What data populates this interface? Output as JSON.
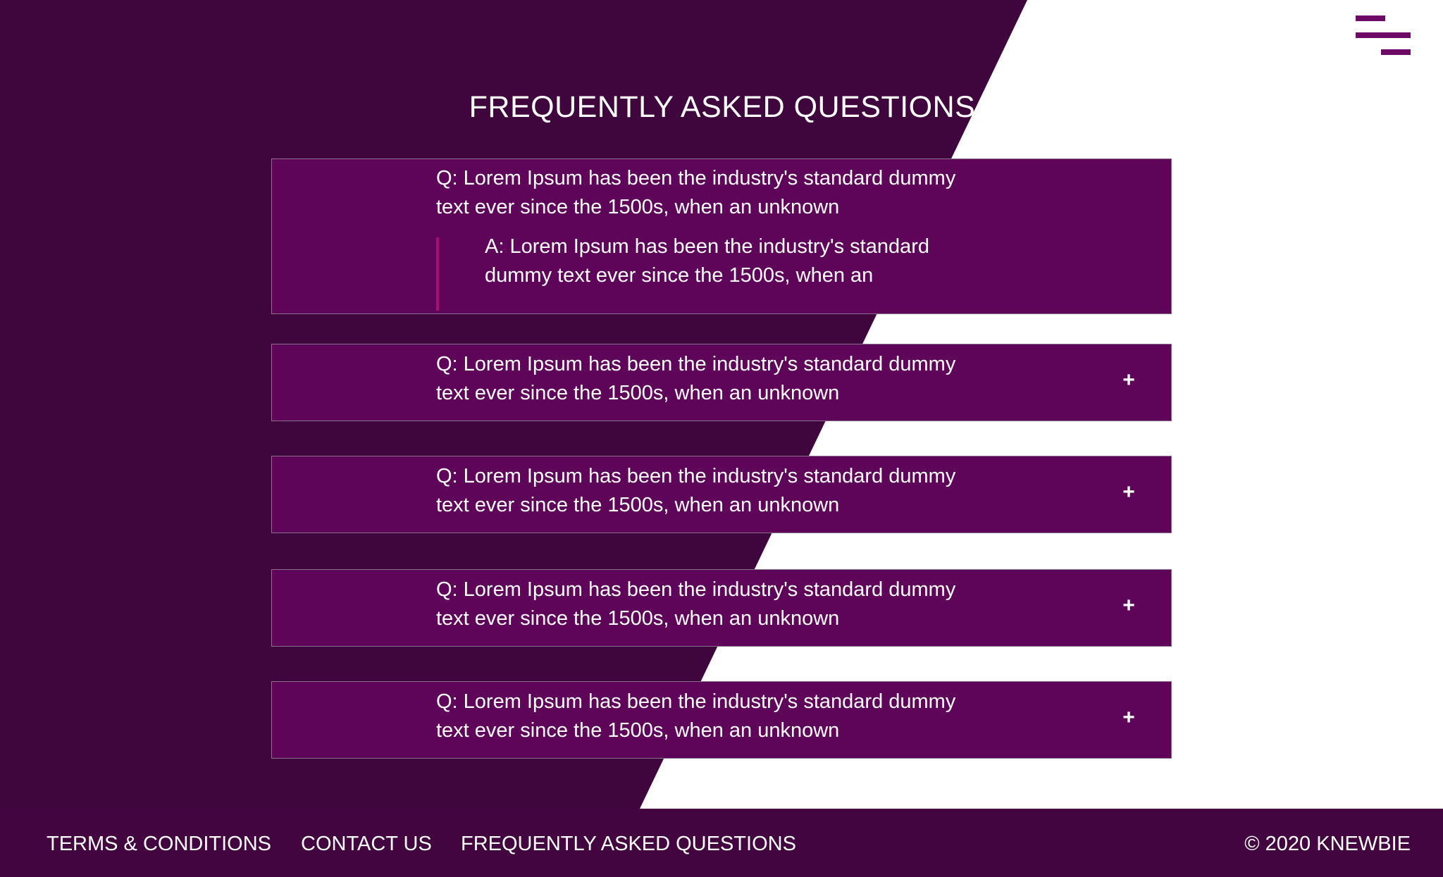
{
  "page": {
    "title": "FREQUENTLY ASKED QUESTIONS"
  },
  "colors": {
    "background_dark": "#3f053d",
    "background_light": "#ffffff",
    "card": "#5e055a",
    "accent": "#a3126e",
    "menu_icon": "#6d0a66",
    "footer": "#42053f"
  },
  "header": {
    "menu_icon": "hamburger-menu-icon"
  },
  "faq": {
    "expanded": {
      "question": "Q: Lorem Ipsum has been the industry's standard dummy text ever since the 1500s, when an unknown",
      "answer": "A: Lorem Ipsum has been the industry's standard dummy text ever since the 1500s, when an"
    },
    "items": [
      {
        "question": "Q: Lorem Ipsum has been the industry's standard dummy text ever since the 1500s, when an unknown",
        "toggle": "+"
      },
      {
        "question": "Q: Lorem Ipsum has been the industry's standard dummy text ever since the 1500s, when an unknown",
        "toggle": "+"
      },
      {
        "question": "Q: Lorem Ipsum has been the industry's standard dummy text ever since the 1500s, when an unknown",
        "toggle": "+"
      },
      {
        "question": "Q: Lorem Ipsum has been the industry's standard dummy text ever since the 1500s, when an unknown",
        "toggle": "+"
      }
    ]
  },
  "footer": {
    "links": [
      {
        "label": "TERMS & CONDITIONS"
      },
      {
        "label": "CONTACT US"
      },
      {
        "label": "FREQUENTLY ASKED QUESTIONS"
      }
    ],
    "copyright": "© 2020 KNEWBIE"
  }
}
